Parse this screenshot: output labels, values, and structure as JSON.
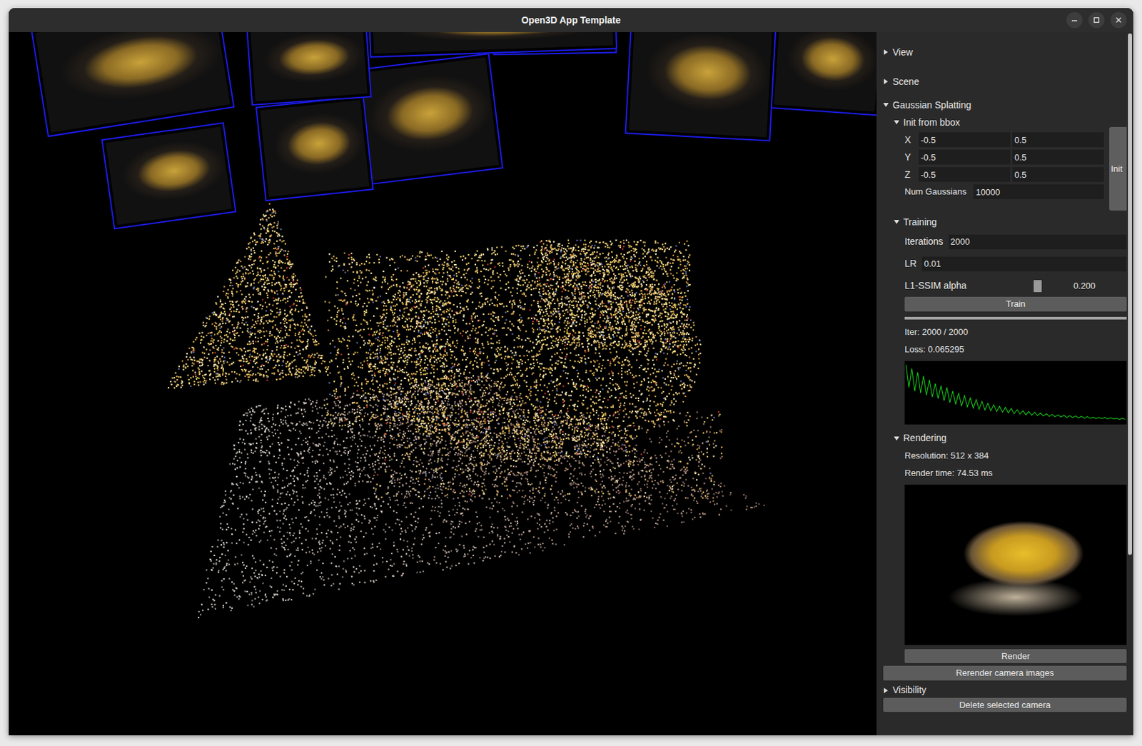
{
  "window": {
    "title": "Open3D App Template"
  },
  "panel": {
    "view_section": {
      "label": "View",
      "expanded": false
    },
    "scene_section": {
      "label": "Scene",
      "expanded": false
    },
    "gaussian_splatting": {
      "label": "Gaussian Splatting",
      "expanded": true,
      "init": {
        "label": "Init from bbox",
        "expanded": true,
        "ranges": [
          {
            "axis": "X",
            "min": "-0.5",
            "max": "0.5"
          },
          {
            "axis": "Y",
            "min": "-0.5",
            "max": "0.5"
          },
          {
            "axis": "Z",
            "min": "-0.5",
            "max": "0.5"
          }
        ],
        "num_label": "Num Gaussians",
        "num_value": "10000",
        "button": "Init"
      },
      "training": {
        "label": "Training",
        "expanded": true,
        "iterations_label": "Iterations",
        "iterations": "2000",
        "lr_label": "LR",
        "lr": "0.01",
        "alpha_label": "L1-SSIM alpha",
        "alpha_level": 0.62,
        "alpha_reading": "0.200",
        "button": "Train",
        "progress": 1.0,
        "iter_text": "Iter: 2000 / 2000",
        "loss_text": "Loss: 0.065295",
        "loss_chart": [
          0.21,
          0.15,
          0.2,
          0.14,
          0.19,
          0.135,
          0.18,
          0.13,
          0.17,
          0.125,
          0.16,
          0.12,
          0.155,
          0.115,
          0.15,
          0.11,
          0.14,
          0.105,
          0.135,
          0.1,
          0.128,
          0.098,
          0.122,
          0.095,
          0.118,
          0.092,
          0.113,
          0.09,
          0.108,
          0.088,
          0.104,
          0.086,
          0.1,
          0.084,
          0.097,
          0.082,
          0.094,
          0.08,
          0.091,
          0.079,
          0.088,
          0.077,
          0.086,
          0.076,
          0.084,
          0.075,
          0.082,
          0.074,
          0.08,
          0.073,
          0.078,
          0.072,
          0.077,
          0.071,
          0.076,
          0.07,
          0.075,
          0.07,
          0.074,
          0.069,
          0.073,
          0.068,
          0.072,
          0.068,
          0.071,
          0.067,
          0.07,
          0.067,
          0.07,
          0.066,
          0.069,
          0.066,
          0.068,
          0.065,
          0.068,
          0.065
        ]
      },
      "rendering": {
        "label": "Rendering",
        "expanded": true,
        "resolution": "Resolution: 512 x 384",
        "render_time": "Render time: 74.53 ms",
        "button": "Render"
      }
    },
    "rerender_button": "Rerender camera images",
    "visibility_section": {
      "label": "Visibility",
      "expanded": false
    },
    "delete_button": "Delete selected camera"
  }
}
